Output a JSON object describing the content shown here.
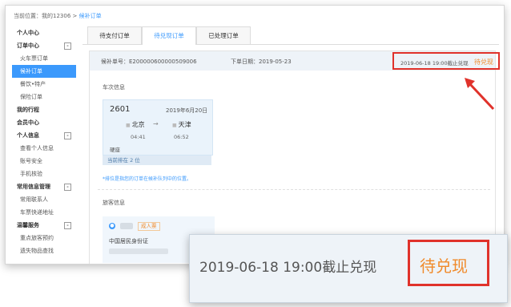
{
  "breadcrumb": {
    "prefix": "当前位置：我的12306 >",
    "current": "候补订单"
  },
  "sidebar": {
    "items": [
      {
        "label": "个人中心",
        "type": "head"
      },
      {
        "label": "订单中心",
        "type": "head",
        "collapse": "-"
      },
      {
        "label": "火车票订单",
        "type": "item"
      },
      {
        "label": "候补订单",
        "type": "item",
        "active": true
      },
      {
        "label": "餐饮•特产",
        "type": "item"
      },
      {
        "label": "保险订单",
        "type": "item"
      },
      {
        "label": "我的行程",
        "type": "head"
      },
      {
        "label": "会员中心",
        "type": "head"
      },
      {
        "label": "个人信息",
        "type": "head",
        "collapse": "-"
      },
      {
        "label": "查看个人信息",
        "type": "item"
      },
      {
        "label": "账号安全",
        "type": "item"
      },
      {
        "label": "手机核验",
        "type": "item"
      },
      {
        "label": "常用信息管理",
        "type": "head",
        "collapse": "-"
      },
      {
        "label": "常用联系人",
        "type": "item"
      },
      {
        "label": "车票快递地址",
        "type": "item"
      },
      {
        "label": "温馨服务",
        "type": "head",
        "collapse": "-"
      },
      {
        "label": "重点旅客预约",
        "type": "item"
      },
      {
        "label": "遗失物品查找",
        "type": "item"
      }
    ]
  },
  "tabs": [
    {
      "label": "待支付订单"
    },
    {
      "label": "待兑现订单",
      "active": true
    },
    {
      "label": "已处理订单"
    }
  ],
  "order": {
    "number_text": "候补单号：E200000600000509006",
    "date_text": "下单日期：2019-05-23",
    "deadline_text": "2019-06-18 19:00截止兑现",
    "status": "待兑现"
  },
  "train_section": {
    "title": "车次信息",
    "train_no": "2601",
    "date": "2019年6月20日",
    "from": "北京",
    "to": "天津",
    "arrow": "→",
    "depart_time": "04:41",
    "arrive_time": "06:52",
    "seat": "硬座",
    "queue": "当前排在 2 位",
    "hint": "*排位是指您的订单在候补队列中的位置。"
  },
  "passenger_section": {
    "title": "旅客信息",
    "type_badge": "成人票",
    "id_type": "中国居民身份证"
  },
  "zoom": {
    "deadline_text": "2019-06-18 19:00截止兑现",
    "status": "待兑现"
  },
  "colors": {
    "accent": "#3b99fc",
    "status": "#f08a2a",
    "highlight": "#e0322b"
  }
}
